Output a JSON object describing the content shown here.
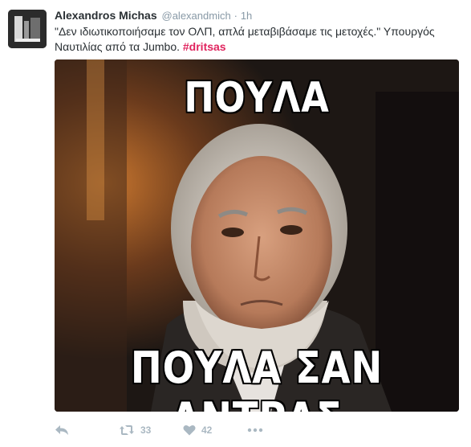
{
  "tweet": {
    "fullname": "Alexandros Michas",
    "handle": "@alexandmich",
    "separator": "·",
    "time": "1h",
    "text": "\"Δεν ιδιωτικοποιήσαμε τον ΟΛΠ, απλά μεταβιβάσαμε τις μετοχές.\" Υπουργός Ναυτιλίας από τα Jumbo. ",
    "hashtag": "#dritsas"
  },
  "meme": {
    "top_text": "ΠΟΥΛΑ",
    "bottom_text": "ΠΟΥΛΑ ΣΑΝ ΑΝΤΡΑΣ"
  },
  "actions": {
    "reply_icon": "reply-icon",
    "retweet_icon": "retweet-icon",
    "retweet_count": "33",
    "like_icon": "heart-icon",
    "like_count": "42",
    "more_icon": "more-icon"
  },
  "colors": {
    "hashtag": "#e0245e",
    "muted": "#8899a6",
    "action": "#aab8c2"
  }
}
